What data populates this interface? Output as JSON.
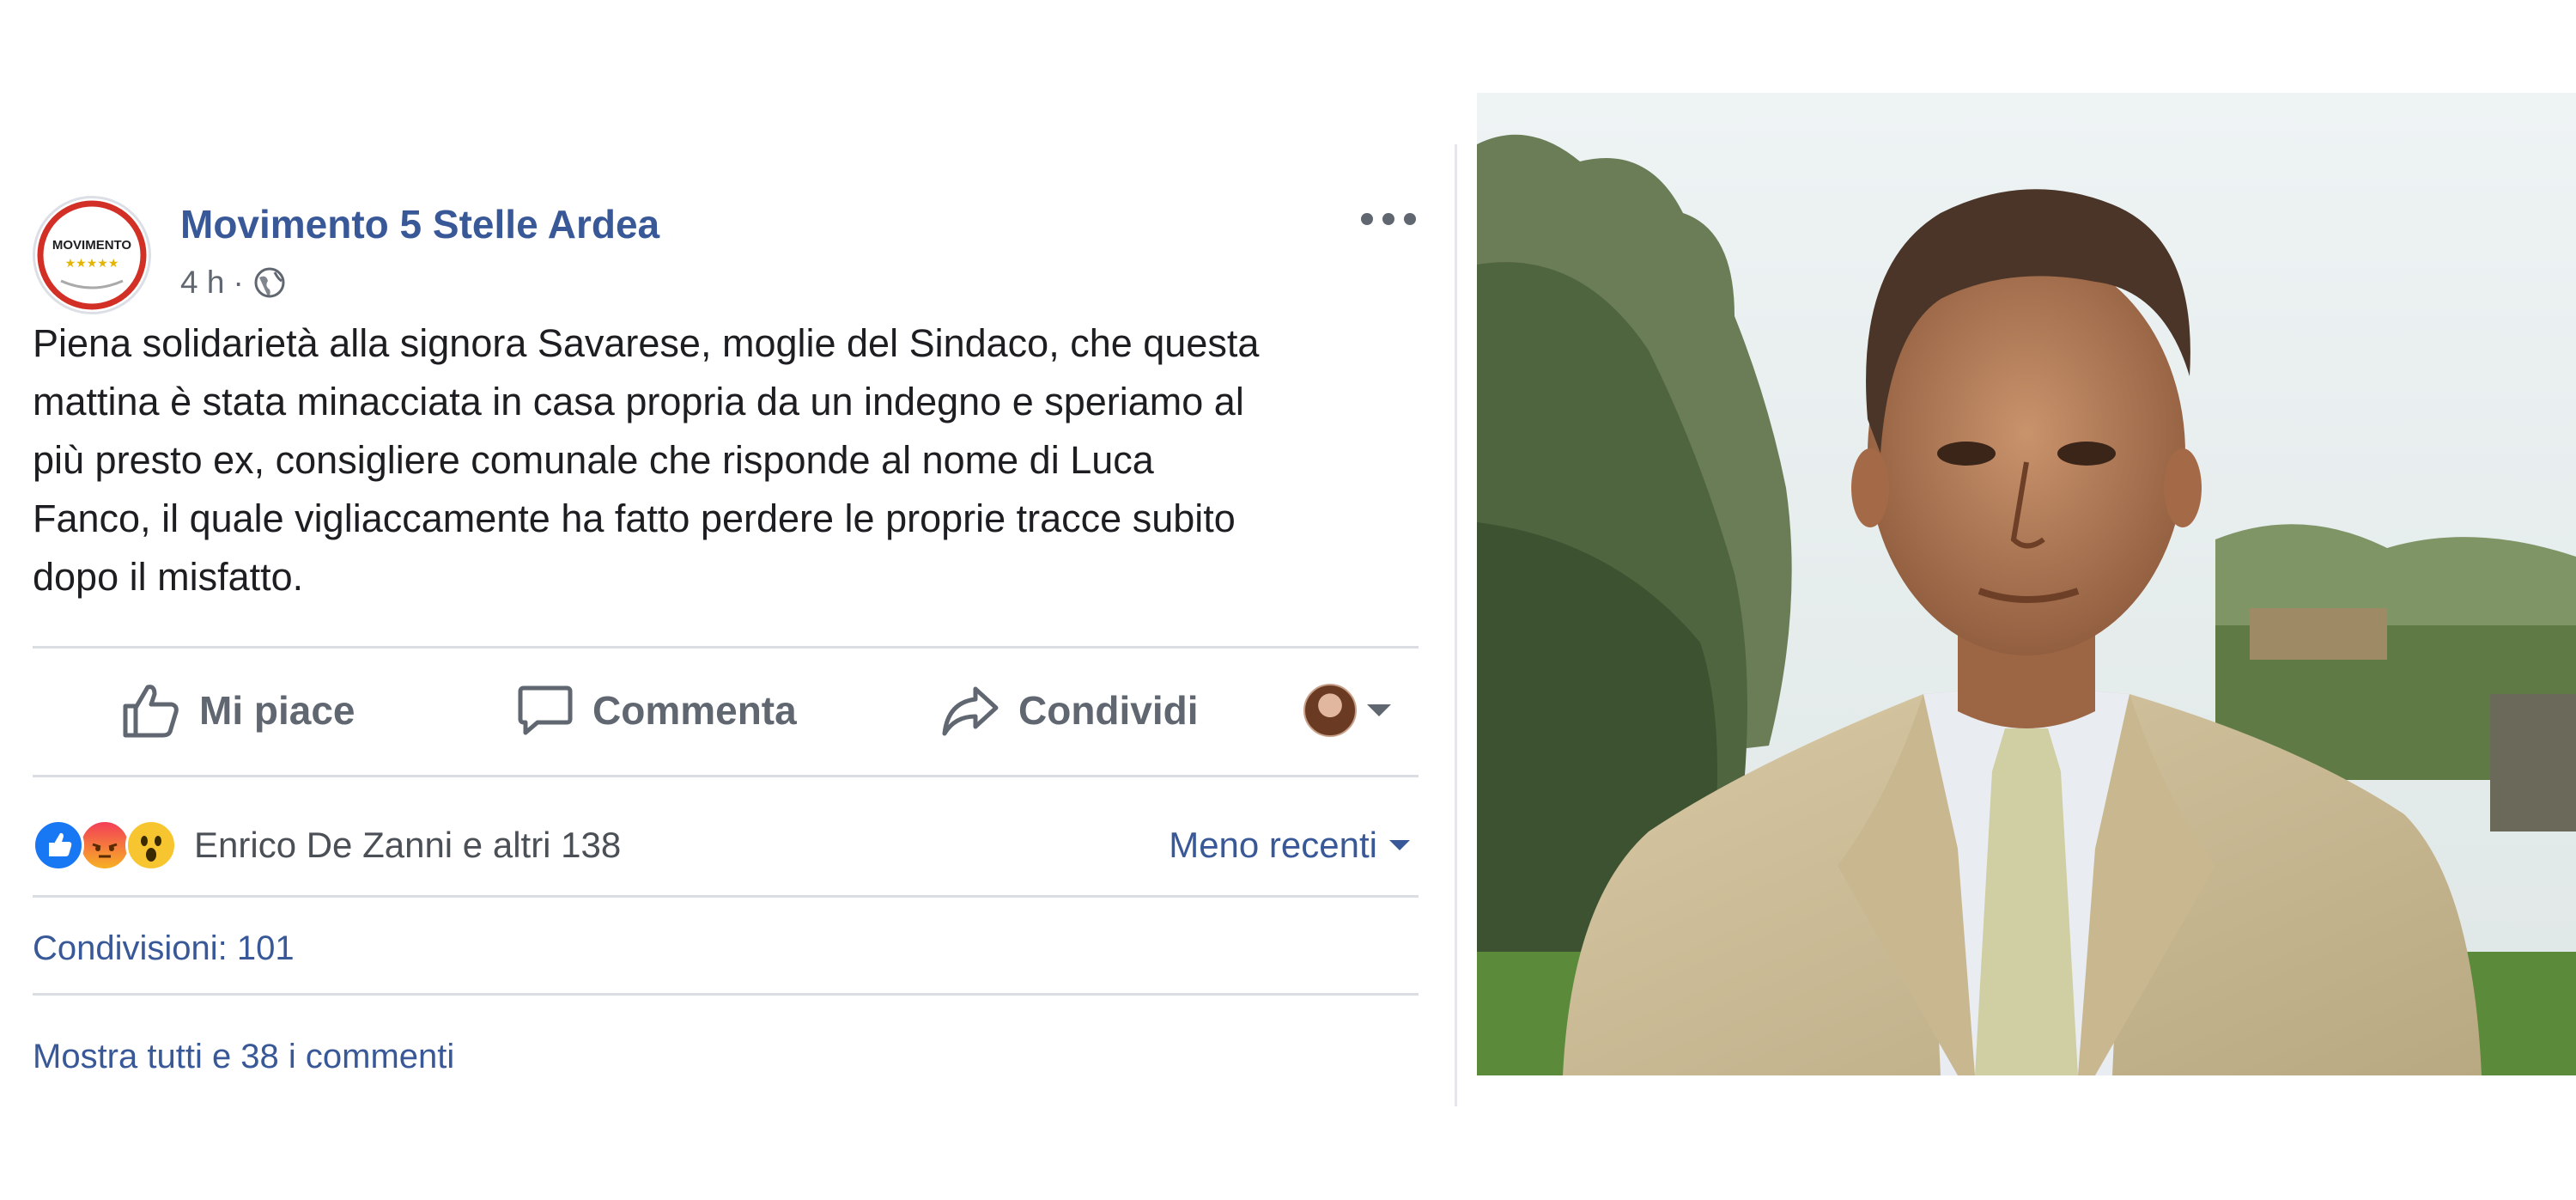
{
  "post": {
    "page_name": "Movimento 5 Stelle Ardea",
    "time": "4 h",
    "separator": "·",
    "text": "Piena solidarietà alla signora Savarese, moglie del Sindaco, che questa\nmattina è stata minacciata in casa propria da un indegno e speriamo al\npiù presto ex, consigliere comunale che risponde al nome di Luca\nFanco, il quale vigliaccamente ha fatto perdere le proprie tracce subito\ndopo il misfatto.",
    "avatar_logo_text": "MOVIMENTO",
    "icons": [
      "ellipsis-icon",
      "globe-icon",
      "thumbs-up-icon",
      "comment-icon",
      "share-icon"
    ]
  },
  "actions": {
    "like_label": "Mi piace",
    "comment_label": "Commenta",
    "share_label": "Condividi"
  },
  "reactions": {
    "names": "Enrico De Zanni e altri 138",
    "sort_label": "Meno recenti",
    "types": [
      "like",
      "angry",
      "wow"
    ]
  },
  "shares_text": "Condivisioni: 101",
  "comments_link": "Mostra tutti e 38 i commenti",
  "colors": {
    "link_blue": "#385898",
    "text": "#1c1e21",
    "muted": "#606770",
    "divider": "#dadde1"
  }
}
